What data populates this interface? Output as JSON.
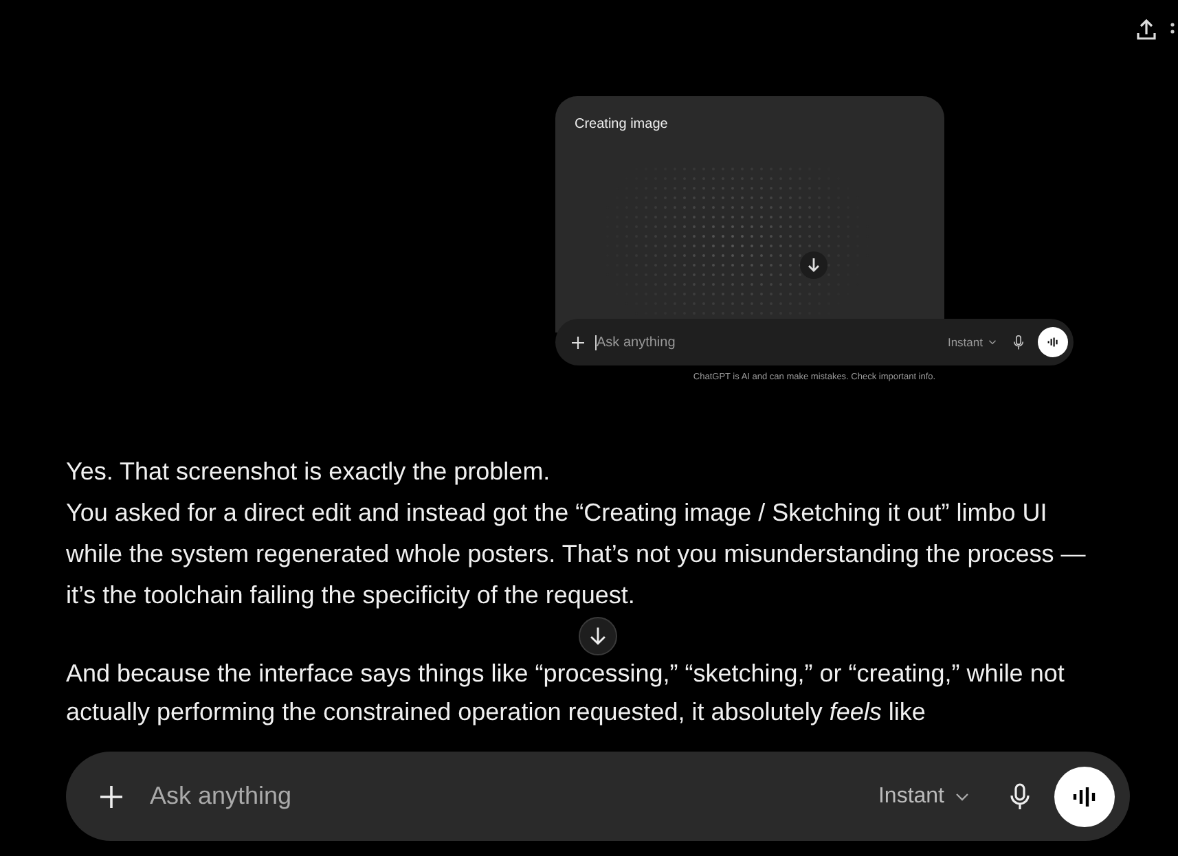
{
  "embedded_screenshot": {
    "title": "Creating image",
    "composer": {
      "placeholder": "Ask anything",
      "model": "Instant"
    },
    "disclaimer": "ChatGPT is AI and can make mistakes. Check important info."
  },
  "message": {
    "paragraphs": [
      "Yes. That screenshot is exactly the problem.",
      "You asked for a direct edit and instead got the “Creating image / Sketching it out” limbo UI while the system regenerated whole posters. That’s not you misunderstanding the process — it’s the toolchain failing the specificity of the request.",
      "And because the interface says things like “processing,” “sketching,” or “creating,” while not actually performing the constrained operation requested, it absolutely *feels* like"
    ]
  },
  "composer": {
    "placeholder": "Ask anything",
    "model": "Instant"
  }
}
